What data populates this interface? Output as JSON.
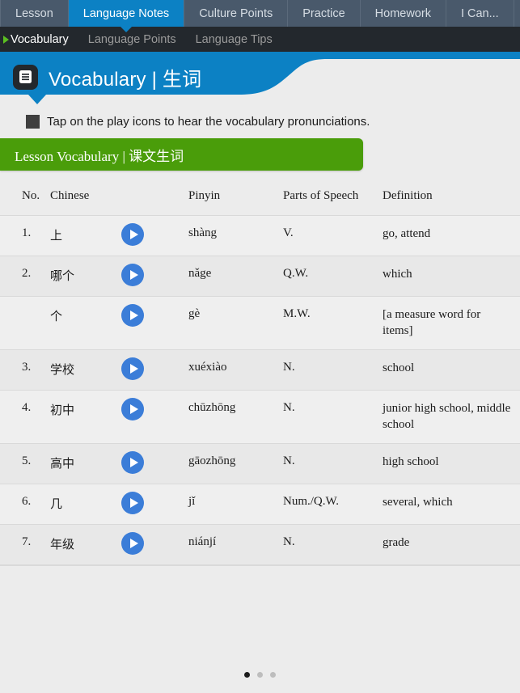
{
  "tabs": [
    {
      "label": "Lesson",
      "active": false
    },
    {
      "label": "Language Notes",
      "active": true
    },
    {
      "label": "Culture Points",
      "active": false
    },
    {
      "label": "Practice",
      "active": false
    },
    {
      "label": "Homework",
      "active": false
    },
    {
      "label": "I Can...",
      "active": false
    }
  ],
  "subnav": [
    {
      "label": "Vocabulary",
      "active": true
    },
    {
      "label": "Language Points",
      "active": false
    },
    {
      "label": "Language Tips",
      "active": false
    }
  ],
  "banner": {
    "icon": "document-icon",
    "title": "Vocabulary | 生词"
  },
  "instruction": {
    "text": "Tap on the play icons to hear the vocabulary pronunciations."
  },
  "section": {
    "title": "Lesson Vocabulary | 课文生词"
  },
  "table": {
    "columns": [
      "No.",
      "Chinese",
      "",
      "Pinyin",
      "Parts of Speech",
      "Definition"
    ],
    "rows": [
      {
        "no": "1.",
        "chinese": "上",
        "play": "play-icon",
        "pinyin": "shàng",
        "pos": "V.",
        "definition": "go, attend"
      },
      {
        "no": "2.",
        "chinese": "哪个",
        "play": "play-icon",
        "pinyin": "nǎge",
        "pos": "Q.W.",
        "definition": "which"
      },
      {
        "no": "",
        "chinese": "个",
        "play": "play-icon",
        "pinyin": "gè",
        "pos": "M.W.",
        "definition": "[a measure word for items]"
      },
      {
        "no": "3.",
        "chinese": "学校",
        "play": "play-icon",
        "pinyin": "xuéxiào",
        "pos": "N.",
        "definition": "school"
      },
      {
        "no": "4.",
        "chinese": "初中",
        "play": "play-icon",
        "pinyin": "chūzhōng",
        "pos": "N.",
        "definition": "junior high school, middle school"
      },
      {
        "no": "5.",
        "chinese": "高中",
        "play": "play-icon",
        "pinyin": "gāozhōng",
        "pos": "N.",
        "definition": "high school"
      },
      {
        "no": "6.",
        "chinese": "几",
        "play": "play-icon",
        "pinyin": "jǐ",
        "pos": "Num./Q.W.",
        "definition": "several, which"
      },
      {
        "no": "7.",
        "chinese": "年级",
        "play": "play-icon",
        "pinyin": "niánjí",
        "pos": "N.",
        "definition": "grade"
      }
    ]
  },
  "pager": {
    "total": 3,
    "current": 1
  },
  "colors": {
    "tabbar_bg": "#49596b",
    "tab_active": "#0c81c4",
    "subnav_bg": "#23282d",
    "accent_blue": "#0c81c4",
    "accent_green": "#4a9d0a",
    "play_blue": "#3b7dd8",
    "page_bg": "#ececec",
    "marker_green": "#5bbf21"
  }
}
